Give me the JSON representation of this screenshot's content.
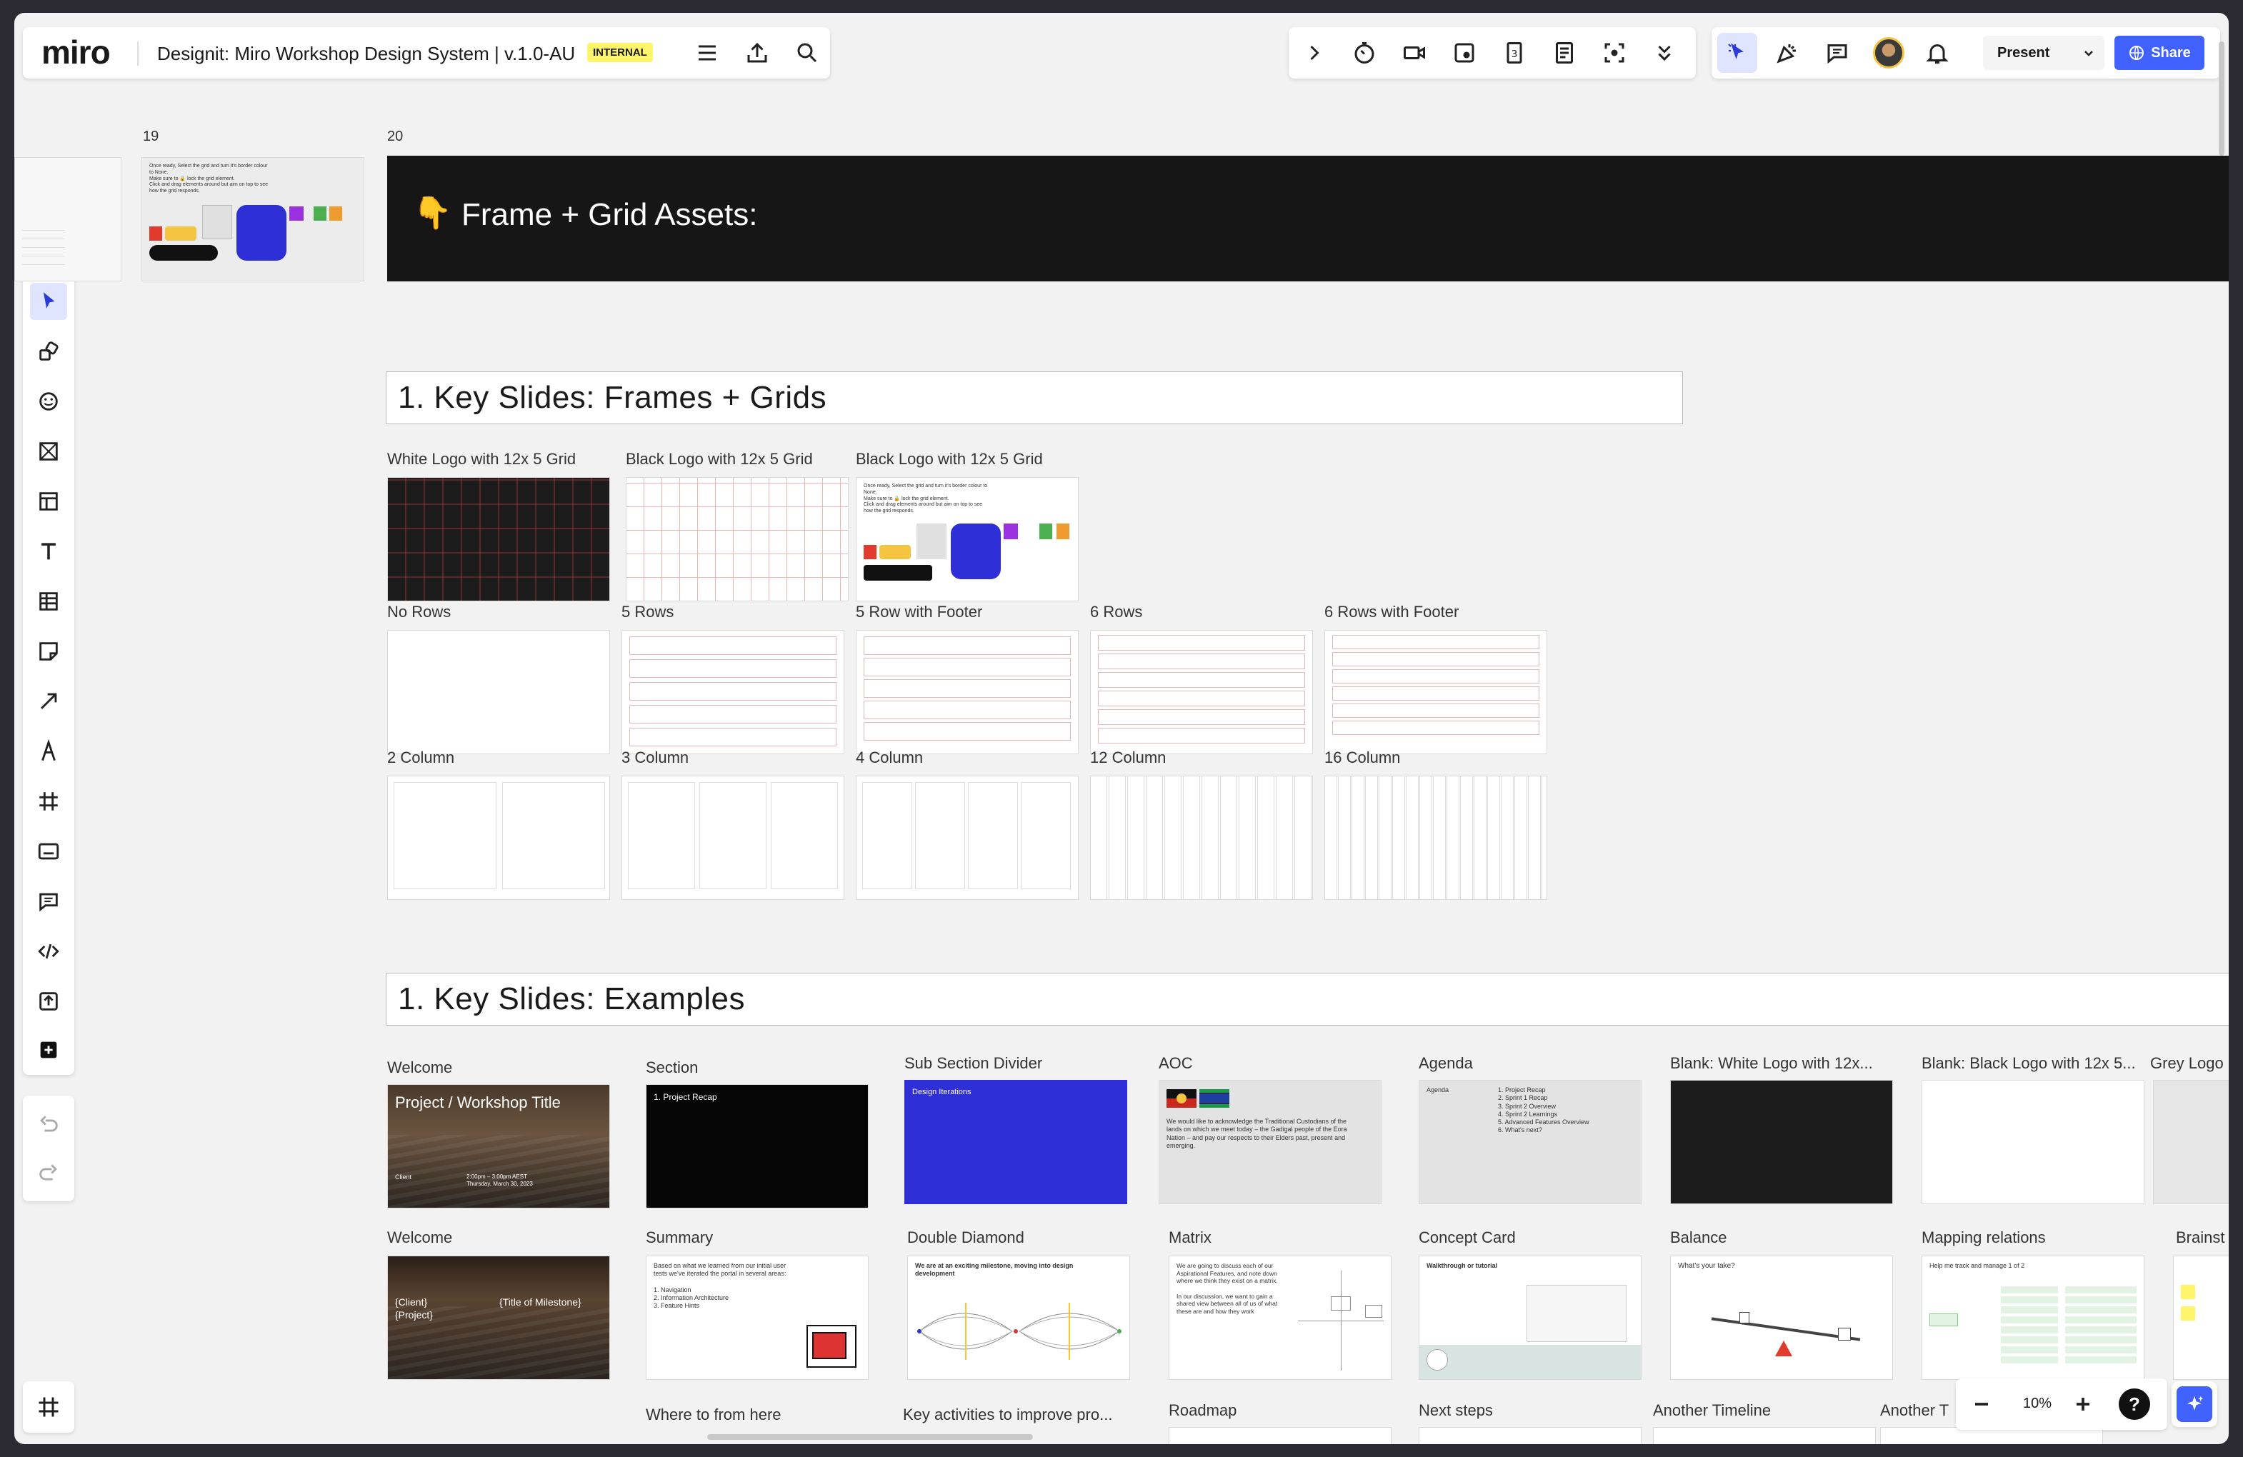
{
  "app": {
    "logo": "miro",
    "board_title": "Designit: Miro Workshop Design System | v.1.0-AU",
    "badge": "INTERNAL",
    "present_label": "Present",
    "share_label": "Share",
    "zoom": "10%"
  },
  "canvas": {
    "frame_numbers": [
      "19",
      "20"
    ],
    "banner_title": "Frame + Grid Assets:",
    "banner_emoji": "👇",
    "section1_title": "1.  Key Slides: Frames + Grids",
    "section2_title": "1.  Key Slides: Examples",
    "grid_labels": {
      "white_logo": "White Logo with 12x 5 Grid",
      "black_logo": "Black Logo with 12x 5 Grid",
      "black_logo2": "Black Logo with 12x 5 Grid",
      "no_rows": "No Rows",
      "five_rows": "5 Rows",
      "five_row_footer": "5 Row with Footer",
      "six_rows": "6 Rows",
      "six_rows_footer": "6 Rows with Footer",
      "two_col": "2 Column",
      "three_col": "3 Column",
      "four_col": "4 Column",
      "twelve_col": "12 Column",
      "sixteen_col": "16 Column"
    },
    "example_labels": {
      "welcome1": "Welcome",
      "section": "Section",
      "subsection": "Sub Section Divider",
      "aoc": "AOC",
      "agenda": "Agenda",
      "blank_white": "Blank: White Logo with 12x...",
      "blank_black": "Blank: Black Logo with 12x 5...",
      "grey_logo": "Grey Logo",
      "welcome2": "Welcome",
      "summary": "Summary",
      "double_diamond": "Double Diamond",
      "matrix": "Matrix",
      "concept_card": "Concept Card",
      "balance": "Balance",
      "mapping": "Mapping relations",
      "brainstorm": "Brainst",
      "where_to": "Where to from here",
      "key_activities": "Key activities to improve pro...",
      "roadmap": "Roadmap",
      "next_steps": "Next steps",
      "another_timeline": "Another Timeline",
      "another_t2": "Another T"
    },
    "thumbs": {
      "welcome_title": "Project / Workshop Title",
      "welcome_client": "Client",
      "welcome_time": "2:00pm – 3:00pm AEST\nThursday, March 30, 2023",
      "section_text": "1. Project Recap",
      "subsection_text": "Design Iterations",
      "aoc_text": "We would like to acknowledge the Traditional Custodians of the lands on which we meet today – the Gadigal people of the Eora Nation – and pay our respects to their Elders past, present and emerging.",
      "agenda_title": "Agenda",
      "agenda_items": "1. Project Recap\n2. Sprint 1 Recap\n3. Sprint 2 Overview\n4. Sprint 2 Learnings\n5. Advanced Features Overview\n6. What's next?",
      "welcome2_client": "{Client}\n{Project}",
      "welcome2_milestone": "{Title of Milestone}",
      "summary_text": "Based on what we learned from our initial user tests we've iterated the portal in several areas:\n\n1. Navigation\n2. Information Architecture\n3. Feature Hints",
      "dd_text": "We are at an exciting milestone, moving into design development",
      "matrix_text": "We are going to discuss each of our Aspirational Features, and note down where we think they exist on a matrix.\n\nIn our discussion, we want to gain a shared view between all of us of what these are and how they work",
      "concept_text": "Walkthrough or tutorial",
      "balance_text": "What's your take?",
      "mapping_text": "Help me track and manage 1 of 2",
      "card_note": "Once ready, Select the grid and turn it's border colour to None.\nMake sure to 🔒 lock the grid element.\nClick and drag elements around but aim on top to see how the grid responds."
    }
  },
  "colors": {
    "share_blue": "#4262ff",
    "badge_yellow": "#fff46a",
    "subsection_blue": "#2f2fd8",
    "banner_black": "#161616"
  }
}
